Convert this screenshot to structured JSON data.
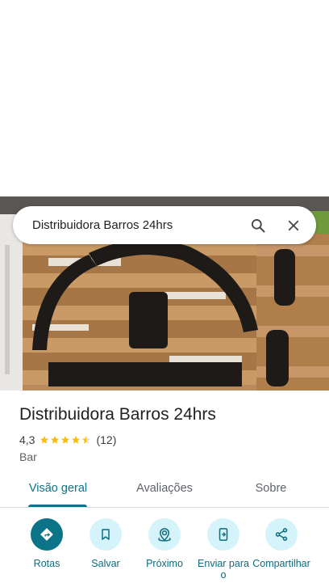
{
  "search": {
    "query": "Distribuidora Barros 24hrs",
    "search_icon": "search-icon",
    "close_icon": "close-icon"
  },
  "photo": {
    "description_icon": "storefront-photo"
  },
  "place": {
    "name": "Distribuidora Barros 24hrs",
    "rating": "4,3",
    "stars": 4.3,
    "review_count": "(12)",
    "category": "Bar"
  },
  "tabs": [
    {
      "label": "Visão geral",
      "active": true
    },
    {
      "label": "Avaliações",
      "active": false
    },
    {
      "label": "Sobre",
      "active": false
    }
  ],
  "actions": [
    {
      "label": "Rotas",
      "icon": "directions-icon"
    },
    {
      "label": "Salvar",
      "icon": "bookmark-icon"
    },
    {
      "label": "Próximo",
      "icon": "nearby-icon"
    },
    {
      "label": "Enviar para o",
      "icon": "send-to-phone-icon"
    },
    {
      "label": "Compartilhar",
      "icon": "share-icon"
    }
  ],
  "colors": {
    "accent": "#0b7488",
    "action_bg": "#d5f3fa",
    "star": "#fbbc04"
  }
}
